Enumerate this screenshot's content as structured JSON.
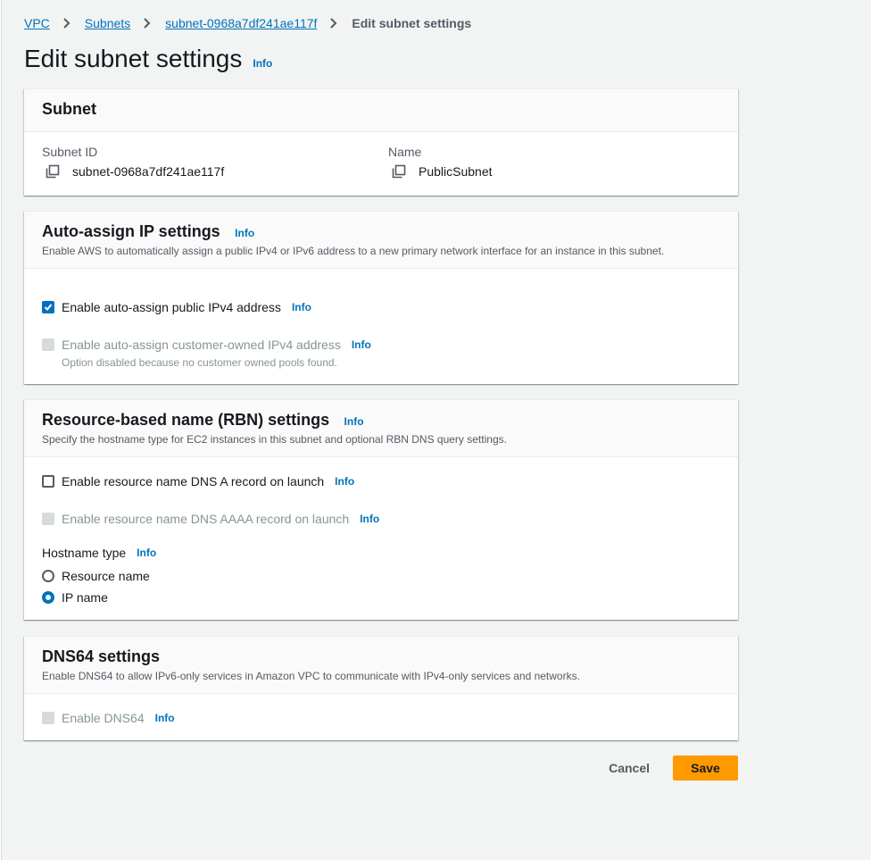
{
  "breadcrumb": {
    "items": [
      "VPC",
      "Subnets",
      "subnet-0968a7df241ae117f"
    ],
    "current": "Edit subnet settings"
  },
  "page": {
    "title": "Edit subnet settings",
    "info": "Info"
  },
  "subnet_card": {
    "title": "Subnet",
    "subnet_id_label": "Subnet ID",
    "subnet_id_value": "subnet-0968a7df241ae117f",
    "name_label": "Name",
    "name_value": "PublicSubnet"
  },
  "auto_assign_card": {
    "title": "Auto-assign IP settings",
    "info": "Info",
    "description": "Enable AWS to automatically assign a public IPv4 or IPv6 address to a new primary network interface for an instance in this subnet.",
    "ipv4_label": "Enable auto-assign public IPv4 address",
    "ipv4_checked": true,
    "customer_owned_label": "Enable auto-assign customer-owned IPv4 address",
    "customer_owned_disabled": true,
    "customer_owned_note": "Option disabled because no customer owned pools found."
  },
  "rbn_card": {
    "title": "Resource-based name (RBN) settings",
    "info": "Info",
    "description": "Specify the hostname type for EC2 instances in this subnet and optional RBN DNS query settings.",
    "dns_a_label": "Enable resource name DNS A record on launch",
    "dns_a_checked": false,
    "dns_aaaa_label": "Enable resource name DNS AAAA record on launch",
    "dns_aaaa_disabled": true,
    "hostname_label": "Hostname type",
    "hostname_options": [
      "Resource name",
      "IP name"
    ],
    "hostname_selected": "IP name"
  },
  "dns64_card": {
    "title": "DNS64 settings",
    "description": "Enable DNS64 to allow IPv6-only services in Amazon VPC to communicate with IPv4-only services and networks.",
    "enable_label": "Enable DNS64",
    "enable_disabled": true,
    "info": "Info"
  },
  "actions": {
    "cancel": "Cancel",
    "save": "Save"
  },
  "colors": {
    "link": "#0073bb",
    "primary": "#ff9900",
    "background": "#f2f3f3"
  }
}
